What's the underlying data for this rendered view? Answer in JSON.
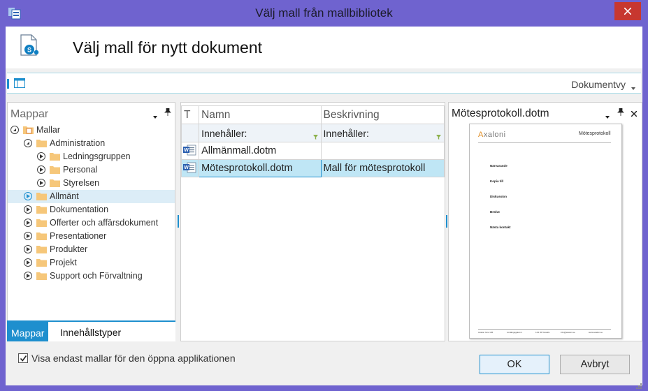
{
  "window": {
    "title": "Välj mall från mallbibliotek"
  },
  "header": {
    "heading": "Välj mall för nytt dokument"
  },
  "toolbar": {
    "view_label": "Dokumentvy"
  },
  "left_panel": {
    "title": "Mappar",
    "tree": [
      {
        "label": "Mallar",
        "level": 0,
        "state": "expanded",
        "icon": "folder-library-icon"
      },
      {
        "label": "Administration",
        "level": 1,
        "state": "expanded",
        "icon": "folder-icon"
      },
      {
        "label": "Ledningsgruppen",
        "level": 2,
        "state": "collapsed",
        "icon": "folder-icon"
      },
      {
        "label": "Personal",
        "level": 2,
        "state": "collapsed",
        "icon": "folder-icon"
      },
      {
        "label": "Styrelsen",
        "level": 2,
        "state": "collapsed",
        "icon": "folder-icon"
      },
      {
        "label": "Allmänt",
        "level": 1,
        "state": "collapsed",
        "icon": "folder-icon",
        "selected": true
      },
      {
        "label": "Dokumentation",
        "level": 1,
        "state": "collapsed",
        "icon": "folder-icon"
      },
      {
        "label": "Offerter och affärsdokument",
        "level": 1,
        "state": "collapsed",
        "icon": "folder-icon"
      },
      {
        "label": "Presentationer",
        "level": 1,
        "state": "collapsed",
        "icon": "folder-icon"
      },
      {
        "label": "Produkter",
        "level": 1,
        "state": "collapsed",
        "icon": "folder-icon"
      },
      {
        "label": "Projekt",
        "level": 1,
        "state": "collapsed",
        "icon": "folder-icon"
      },
      {
        "label": "Support och Förvaltning",
        "level": 1,
        "state": "collapsed",
        "icon": "folder-icon"
      }
    ],
    "tabs": [
      "Mappar",
      "Innehållstyper"
    ]
  },
  "grid": {
    "columns": [
      "T",
      "Namn",
      "Beskrivning"
    ],
    "filter": {
      "name": "Innehåller:",
      "description": "Innehåller:"
    },
    "rows": [
      {
        "name": "Allmänmall.dotm",
        "description": "",
        "icon": "word-template-icon"
      },
      {
        "name": "Mötesprotokoll.dotm",
        "description": "Mall för mötesprotokoll",
        "icon": "word-template-icon",
        "selected": true
      }
    ]
  },
  "preview": {
    "title": "Mötesprotokoll.dotm",
    "page": {
      "logo_prefix": "A",
      "logo_rest": "xaloni",
      "doc_title": "Mötesprotokoll",
      "sections": [
        "Närvarande",
        "Kopia till",
        "Diskussion",
        "Beslut",
        "Nästa kontakt"
      ],
      "footer": [
        "Axalon Gruv AB",
        "Lindängsgatan 1",
        "123 45 Teloräls",
        "info@axalon.se",
        "www.axalon.se"
      ]
    }
  },
  "footer": {
    "checkbox_label": "Visa endast mallar för den öppna applikationen",
    "checkbox_checked": true,
    "ok_label": "OK",
    "cancel_label": "Avbryt"
  },
  "colors": {
    "titlebar": "#6f63cf",
    "accent": "#1e8fce",
    "close_button": "#c7372f",
    "selection": "#bfe6f5",
    "folder": "#f6c77a"
  }
}
